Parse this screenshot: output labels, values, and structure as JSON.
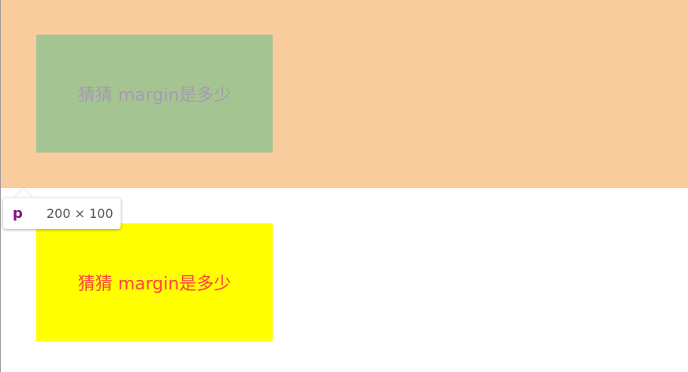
{
  "boxes": {
    "first": {
      "text": "猜猜 margin是多少",
      "background": "#a4c592",
      "margin_highlight": "#f8cc9d",
      "text_color": "#a59ab3"
    },
    "second": {
      "text": "猜猜 margin是多少",
      "background": "#ffff00",
      "text_color": "#ff4040"
    }
  },
  "inspector_tooltip": {
    "tag": "p",
    "dimensions": "200 × 100",
    "tag_color": "#881280"
  }
}
